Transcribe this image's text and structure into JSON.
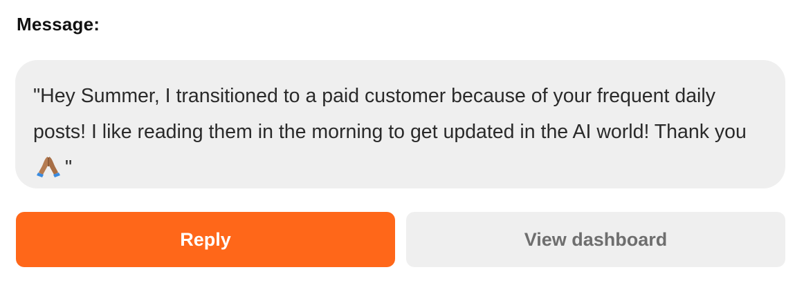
{
  "message": {
    "label": "Message:",
    "text_before_emoji": "\"Hey Summer, I transitioned to a paid customer because of your frequent daily posts! I like reading them in the morning to get updated in the AI world! Thank you",
    "emoji": "folded-hands-emoji",
    "text_after_emoji": "\""
  },
  "actions": {
    "reply_label": "Reply",
    "dashboard_label": "View dashboard"
  },
  "colors": {
    "accent": "#ff6719",
    "bubble_bg": "#efefef",
    "secondary_button_bg": "#efefef",
    "secondary_button_text": "#6e6e6e"
  }
}
